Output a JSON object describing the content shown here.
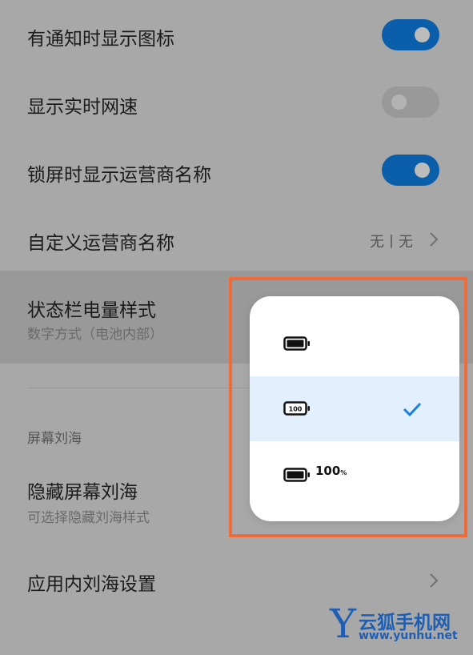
{
  "settings": {
    "notif_icons": {
      "title": "有通知时显示图标",
      "toggle": "on"
    },
    "net_speed": {
      "title": "显示实时网速",
      "toggle": "off"
    },
    "lock_carrier": {
      "title": "锁屏时显示运营商名称",
      "toggle": "on"
    },
    "custom_carrier": {
      "title": "自定义运营商名称",
      "value": "无丨无"
    },
    "battery_style": {
      "title": "状态栏电量样式",
      "subtitle": "数字方式（电池内部）"
    },
    "notch_section": {
      "header": "屏幕刘海"
    },
    "hide_notch": {
      "title": "隐藏屏幕刘海",
      "subtitle": "可选择隐藏刘海样式"
    },
    "app_notch": {
      "title": "应用内刘海设置"
    }
  },
  "battery_popup": {
    "options": [
      {
        "icon": "battery-icon",
        "label": "",
        "selected": false
      },
      {
        "icon": "battery-with-number-inside-icon",
        "inner_text": "100",
        "label": "",
        "selected": true
      },
      {
        "icon": "battery-icon",
        "label": "100",
        "unit": "%",
        "selected": false
      }
    ]
  },
  "watermark": {
    "letter": "Y",
    "name": "云狐手机网",
    "url": "www.yunhu.net"
  },
  "colors": {
    "toggle_on": "#0b5ea9",
    "accent_check": "#1a7ee6",
    "highlight_frame": "#ef6c3a"
  }
}
